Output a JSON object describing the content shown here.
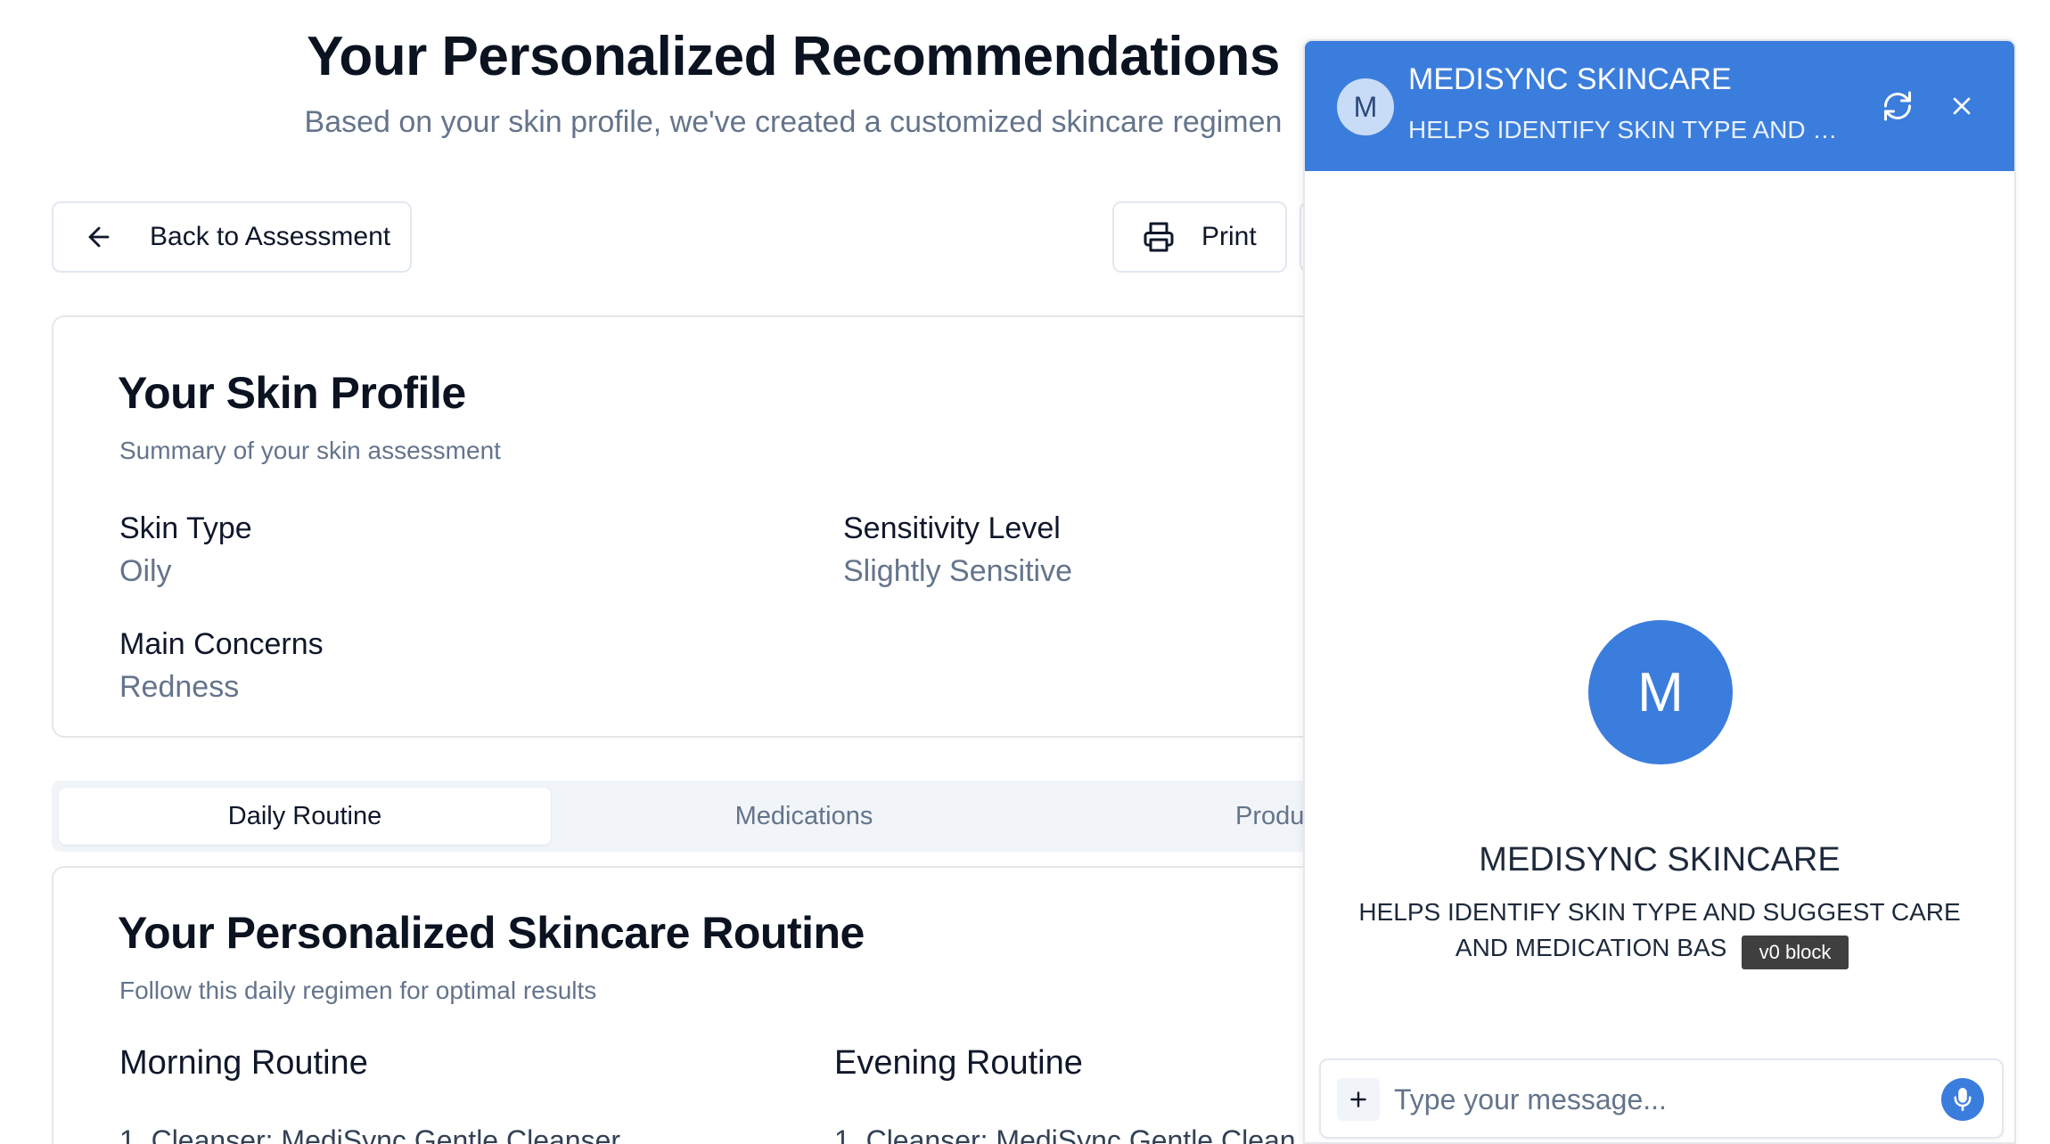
{
  "header": {
    "title": "Your Personalized Recommendations",
    "subtitle": "Based on your skin profile, we've created a customized skincare regimen"
  },
  "toolbar": {
    "back_label": "Back to Assessment",
    "print_label": "Print"
  },
  "profile": {
    "title": "Your Skin Profile",
    "description": "Summary of your skin assessment",
    "fields": [
      {
        "label": "Skin Type",
        "value": "Oily"
      },
      {
        "label": "Sensitivity Level",
        "value": "Slightly Sensitive"
      },
      {
        "label": "Main Concerns",
        "value": "Redness"
      }
    ]
  },
  "tabs": [
    {
      "label": "Daily Routine",
      "active": true
    },
    {
      "label": "Medications",
      "active": false
    },
    {
      "label": "Produ",
      "active": false
    }
  ],
  "routine": {
    "title": "Your Personalized Skincare Routine",
    "description": "Follow this daily regimen for optimal results",
    "morning": {
      "title": "Morning Routine",
      "items": [
        "1. Cleanser: MediSync Gentle Cleanser"
      ]
    },
    "evening": {
      "title": "Evening Routine",
      "items": [
        "1. Cleanser: MediSync Gentle Clean"
      ]
    }
  },
  "chat": {
    "avatar_letter": "M",
    "name": "MEDISYNC SKINCARE",
    "description": "HELPS IDENTIFY SKIN TYPE AND SUGGEST CARE AND MEDICATION BASED ON SKIN TYPE.",
    "description_short": "HELPS IDENTIFY SKIN TYPE AND S...",
    "welcome_name": "MEDISYNC SKINCARE",
    "welcome_desc_line1": "HELPS IDENTIFY SKIN TYPE AND SUGGEST CARE",
    "welcome_desc_line2": "AND MEDICATION BAS",
    "welcome_desc_tail": ".",
    "tooltip": "v0 block",
    "input_placeholder": "Type your message...",
    "icons": {
      "refresh": "refresh-icon",
      "close": "close-icon",
      "plus": "plus-icon",
      "mic": "microphone-icon"
    },
    "accent_color": "#3b7ddd"
  }
}
